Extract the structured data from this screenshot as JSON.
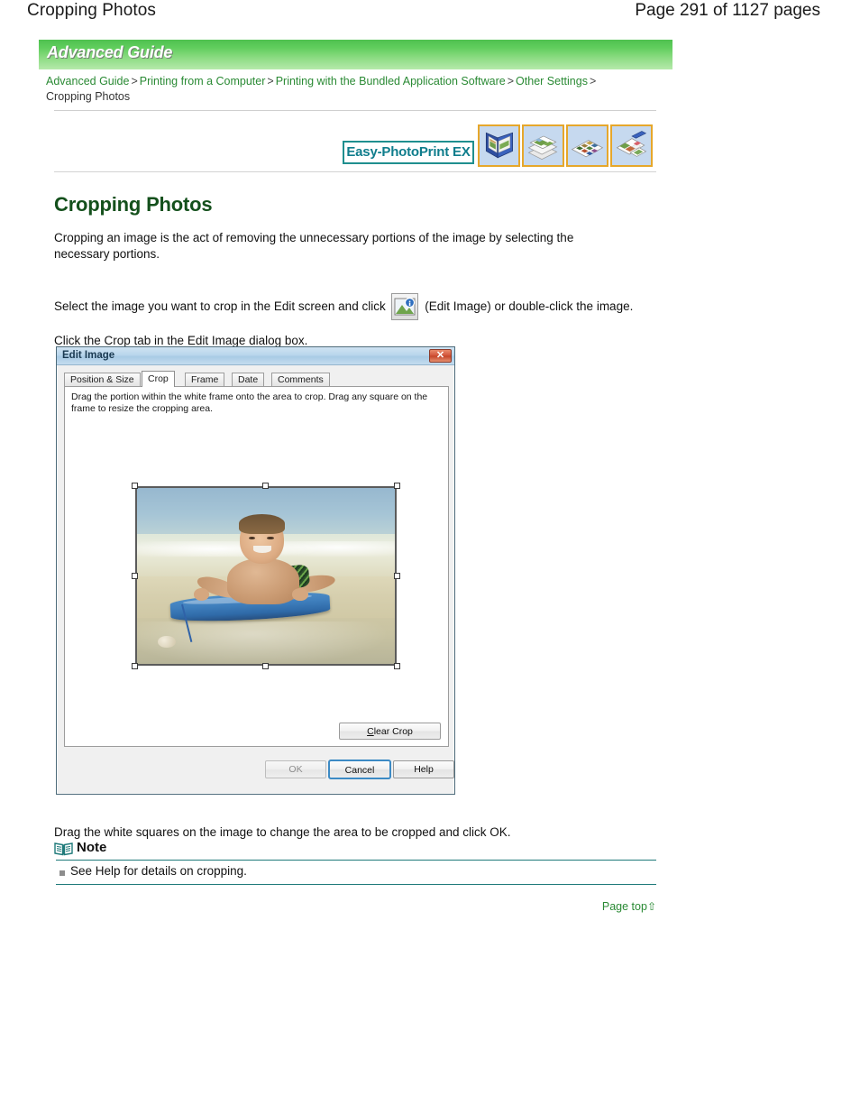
{
  "page_header": {
    "title": "Cropping Photos",
    "page_number": "Page 291 of 1127 pages"
  },
  "banner": {
    "label": "Advanced Guide",
    "gradient_from": "#4fc14f",
    "gradient_to": "#b6e9ab"
  },
  "breadcrumb": {
    "items": [
      {
        "label": "Advanced Guide",
        "link": true
      },
      {
        "label": "Printing from a Computer",
        "link": true
      },
      {
        "label": "Printing with the Bundled Application Software",
        "link": true
      },
      {
        "label": "Other Settings",
        "link": true
      },
      {
        "label": "Cropping Photos",
        "link": false
      }
    ],
    "separator": ">",
    "link_color": "#2a8a34"
  },
  "product_bar": {
    "logo_text": "Easy-PhotoPrint EX",
    "logo_color": "#0f7d8c",
    "icons": [
      {
        "name": "album-icon",
        "label": "Album"
      },
      {
        "name": "photo-print-icon",
        "label": "Photo Print"
      },
      {
        "name": "index-print-icon",
        "label": "Index Print"
      },
      {
        "name": "layout-print-icon",
        "label": "Layout Print"
      }
    ]
  },
  "main": {
    "heading": "Cropping Photos",
    "heading_color": "#14501c",
    "paragraph_1": "Cropping an image is the act of removing the unnecessary portions of the image by selecting the necessary portions.",
    "paragraph_2_before": "Select the image you want to crop in the Edit screen and click",
    "paragraph_2_after": "(Edit Image) or double-click the image.",
    "paragraph_3": "Click the Crop tab in the Edit Image dialog box.",
    "paragraph_4": "Drag the white squares on the image to change the area to be cropped and click OK."
  },
  "dialog": {
    "title": "Edit Image",
    "close_label": "✕",
    "tabs": [
      {
        "label": "Position & Size",
        "selected": false
      },
      {
        "label": "Crop",
        "selected": true
      },
      {
        "label": "Frame",
        "selected": false
      },
      {
        "label": "Date",
        "selected": false
      },
      {
        "label": "Comments",
        "selected": false
      }
    ],
    "instructions": "Drag the portion within the white frame onto the area to crop. Drag any square on the frame to resize the cropping area.",
    "image_alt": "Photo of a young boy lying on a blue bodyboard in shallow beach surf",
    "clear_crop_label": "Clear Crop",
    "clear_crop_accesskey": "C",
    "buttons": {
      "ok": "OK",
      "cancel": "Cancel",
      "help": "Help"
    },
    "ok_enabled": false,
    "cancel_is_default": true
  },
  "note": {
    "heading": "Note",
    "items": [
      "See Help for details on cropping."
    ],
    "rule_color": "#1f7a7a"
  },
  "page_top": {
    "label": "Page top",
    "arrow": "⇧",
    "color": "#2a8a34"
  }
}
